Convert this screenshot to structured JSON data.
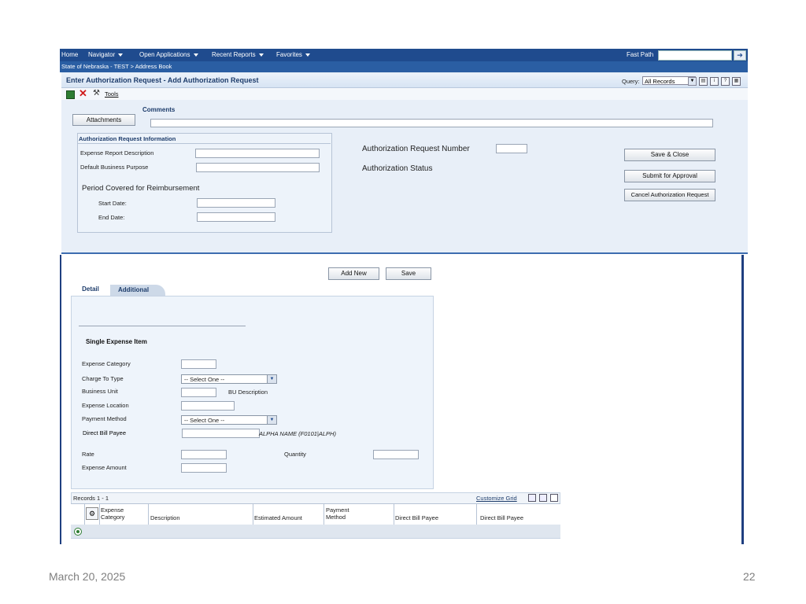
{
  "topbar": {
    "home": "Home",
    "navigator": "Navigator",
    "open_apps": "Open Applications",
    "recent_reports": "Recent Reports",
    "favorites": "Favorites",
    "fast_path": "Fast Path",
    "fast_path_go": "➔"
  },
  "breadcrumb": "State of Nebraska - TEST  >  Address Book",
  "form": {
    "title": "Enter Authorization Request - Add Authorization Request",
    "query_label": "Query:",
    "query_value": "All Records",
    "tools_label": "Tools",
    "comments_label": "Comments",
    "attachments_label": "Attachments",
    "section_title": "Authorization Request Information",
    "expense_report_desc": "Expense Report Description",
    "default_business_purpose": "Default Business Purpose",
    "period_covered": "Period Covered for Reimbursement",
    "start_date": "Start Date:",
    "end_date": "End Date:",
    "auth_request_number": "Authorization Request Number",
    "auth_status": "Authorization Status",
    "save_close": "Save & Close",
    "submit_approval": "Submit for Approval",
    "cancel_request": "Cancel Authorization Request"
  },
  "detail": {
    "add_new": "Add New",
    "save": "Save",
    "tab_detail": "Detail",
    "tab_additional": "Additional",
    "single_item_title": "Single Expense Item",
    "expense_category": "Expense Category",
    "charge_to_type": "Charge To Type",
    "charge_to_value": "-- Select One --",
    "business_unit": "Business Unit",
    "bu_description": "BU Description",
    "expense_location": "Expense Location",
    "payment_method": "Payment Method",
    "payment_method_value": "-- Select One --",
    "direct_bill_payee": "Direct Bill Payee",
    "alpha_name": "ALPHA NAME (F0101|ALPH)",
    "rate": "Rate",
    "quantity": "Quantity",
    "expense_amount": "Expense Amount"
  },
  "grid": {
    "records": "Records 1 - 1",
    "customize": "Customize Grid",
    "columns": [
      "Expense Category",
      "Description",
      "Estimated Amount",
      "Payment Method",
      "Direct Bill Payee",
      "Direct Bill Payee"
    ]
  },
  "footer": {
    "date": "March 20, 2025",
    "page": "22"
  },
  "colors": {
    "topbar": "#1f4b8e",
    "accent": "#3d6db0"
  }
}
